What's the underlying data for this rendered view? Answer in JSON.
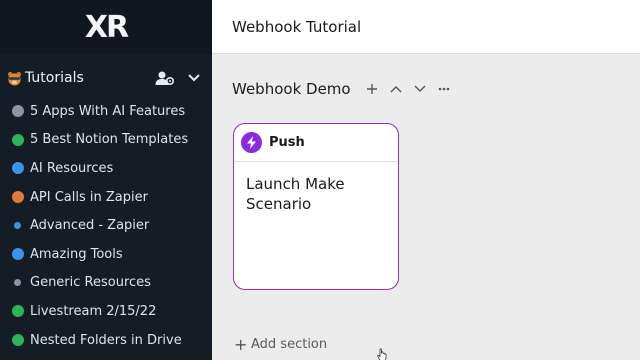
{
  "app": {
    "logo": "XR"
  },
  "workspace": {
    "name": "Tutorials",
    "icon": "bear-face-icon"
  },
  "nav": {
    "items": [
      {
        "label": "5 Apps With AI Features",
        "icon_color": "#8b96a3",
        "kind": "globe"
      },
      {
        "label": "5 Best Notion Templates",
        "icon_color": "#2eb35a",
        "kind": "globe"
      },
      {
        "label": "AI Resources",
        "icon_color": "#3a93e6",
        "kind": "globe"
      },
      {
        "label": "API Calls in Zapier",
        "icon_color": "#e07a3a",
        "kind": "globe"
      },
      {
        "label": "Advanced - Zapier",
        "icon_color": "#3a93e6",
        "kind": "dot"
      },
      {
        "label": "Amazing Tools",
        "icon_color": "#3a93e6",
        "kind": "globe"
      },
      {
        "label": "Generic Resources",
        "icon_color": "#8b96a3",
        "kind": "dot"
      },
      {
        "label": "Livestream 2/15/22",
        "icon_color": "#2eb35a",
        "kind": "globe"
      },
      {
        "label": "Nested Folders in Drive",
        "icon_color": "#2eb35a",
        "kind": "globe"
      }
    ]
  },
  "page": {
    "title": "Webhook Tutorial"
  },
  "section": {
    "title": "Webhook Demo"
  },
  "card": {
    "type_label": "Push",
    "title": "Launch Make Scenario",
    "accent": "#8a2be2"
  },
  "footer": {
    "add_section_label": "Add section"
  }
}
